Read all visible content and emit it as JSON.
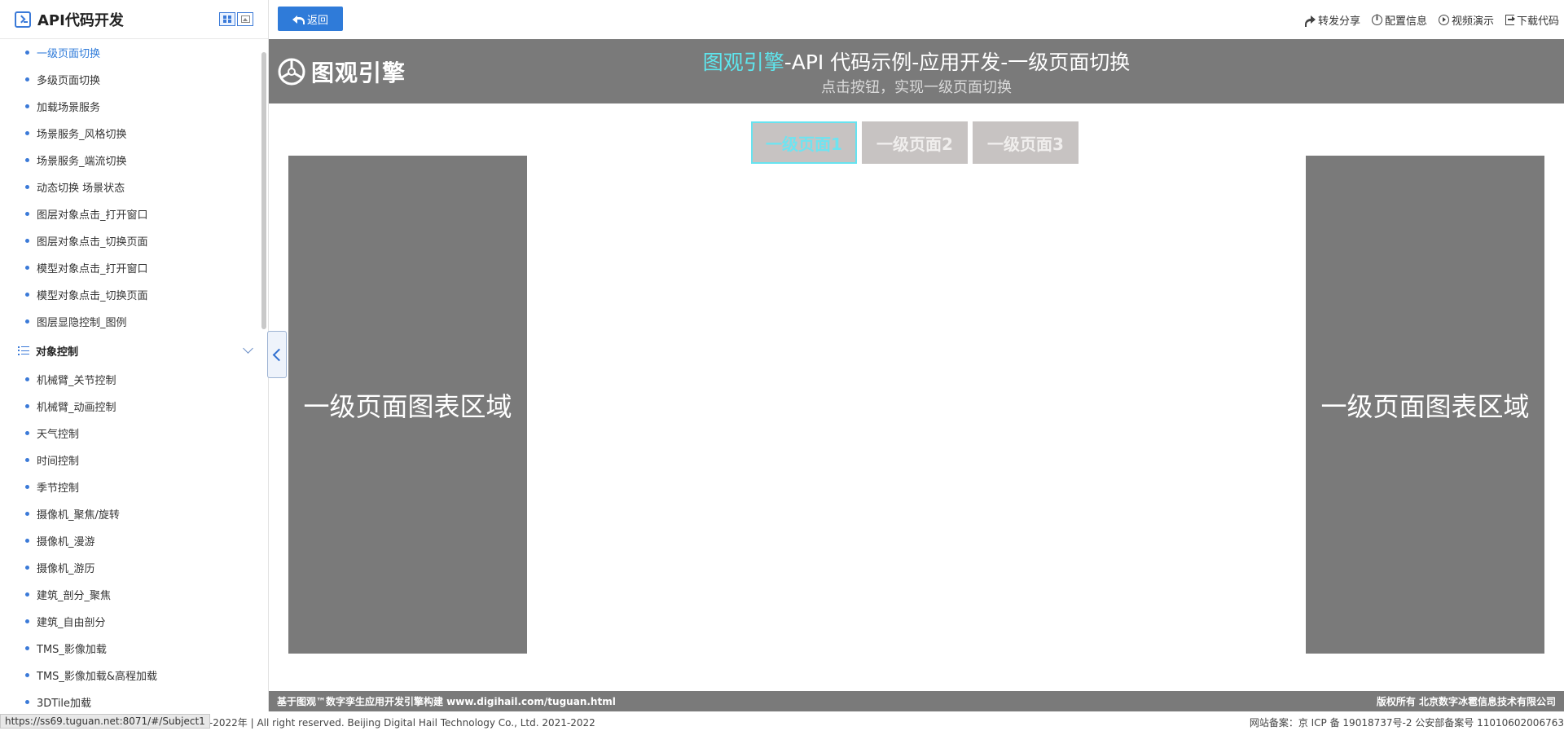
{
  "sidebar": {
    "title": "API代码开发",
    "items_before": [
      {
        "label": "一级页面切换",
        "active": true
      },
      {
        "label": "多级页面切换"
      },
      {
        "label": "加载场景服务"
      },
      {
        "label": "场景服务_风格切换"
      },
      {
        "label": "场景服务_端流切换"
      },
      {
        "label": "动态切换 场景状态"
      },
      {
        "label": "图层对象点击_打开窗口"
      },
      {
        "label": "图层对象点击_切换页面"
      },
      {
        "label": "模型对象点击_打开窗口"
      },
      {
        "label": "模型对象点击_切换页面"
      },
      {
        "label": "图层显隐控制_图例"
      }
    ],
    "group": {
      "label": "对象控制"
    },
    "items_after": [
      {
        "label": "机械臂_关节控制"
      },
      {
        "label": "机械臂_动画控制"
      },
      {
        "label": "天气控制"
      },
      {
        "label": "时间控制"
      },
      {
        "label": "季节控制"
      },
      {
        "label": "摄像机_聚焦/旋转"
      },
      {
        "label": "摄像机_漫游"
      },
      {
        "label": "摄像机_游历"
      },
      {
        "label": "建筑_剖分_聚焦"
      },
      {
        "label": "建筑_自由剖分"
      },
      {
        "label": "TMS_影像加载"
      },
      {
        "label": "TMS_影像加载&高程加载"
      },
      {
        "label": "3DTile加载"
      }
    ]
  },
  "topbar": {
    "back_label": "返回",
    "actions": [
      {
        "label": "转发分享",
        "icon": "share-icon"
      },
      {
        "label": "配置信息",
        "icon": "info-icon"
      },
      {
        "label": "视频演示",
        "icon": "play-icon"
      },
      {
        "label": "下载代码",
        "icon": "download-icon"
      }
    ]
  },
  "banner": {
    "brand": "图观引擎",
    "title_highlight": "图观引擎",
    "title_rest": "-API 代码示例-应用开发-一级页面切换",
    "subtitle": "点击按钮，实现一级页面切换",
    "highlight_color": "#5ee6ee"
  },
  "page_tabs": [
    {
      "label": "一级页面1",
      "active": true
    },
    {
      "label": "一级页面2"
    },
    {
      "label": "一级页面3"
    }
  ],
  "panels": {
    "left": "一级页面图表区域",
    "right": "一级页面图表区域"
  },
  "footer": {
    "left": "基于图观™数字孪生应用开发引擎构建 www.digihail.com/tuguan.html",
    "right": "版权所有 北京数字冰雹信息技术有限公司"
  },
  "bottom": {
    "status_url": "https://ss69.tuguan.net:8071/#/Subject1",
    "copyright": "021-2022年 | All right reserved. Beijing Digital Hail Technology Co., Ltd. 2021-2022",
    "icp": "网站备案：京 ICP 备 19018737号-2 公安部备案号 11010602006763"
  },
  "colors": {
    "accent": "#2f7bd9",
    "banner_bg": "#7a7a7a",
    "tab_bg": "#c7c3c2",
    "tab_active_border": "#66e3f0"
  }
}
